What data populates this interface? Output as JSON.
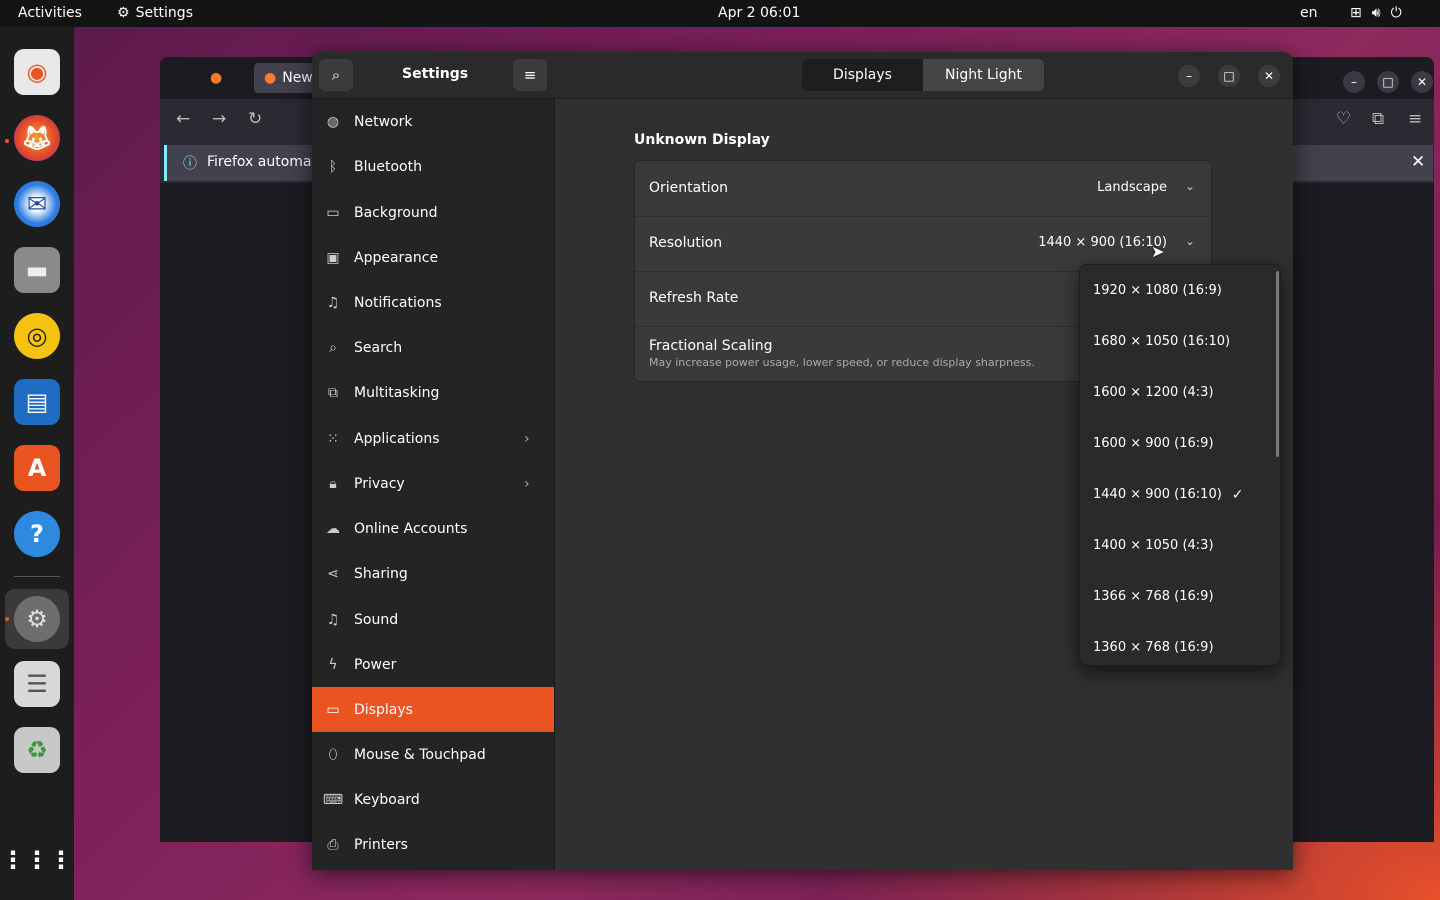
{
  "topbar": {
    "activities": "Activities",
    "app_name": "Settings",
    "clock": "Apr 2  06:01",
    "language": "en"
  },
  "dock": {
    "items": [
      "Ubuntu Logo",
      "Firefox",
      "Thunderbird",
      "Files",
      "Rhythmbox",
      "LibreOffice Writer",
      "Ubuntu Software",
      "Help",
      "Settings",
      "Text Editor",
      "Trash",
      "Show Applications"
    ]
  },
  "firefox": {
    "tab_label": "New",
    "info_bar": "Firefox automat"
  },
  "settings": {
    "title": "Settings",
    "tabs": [
      "Displays",
      "Night Light"
    ],
    "active_tab": "Displays",
    "sidebar": [
      {
        "label": "Network",
        "icon": "network-icon"
      },
      {
        "label": "Bluetooth",
        "icon": "bluetooth-icon"
      },
      {
        "label": "Background",
        "icon": "background-icon"
      },
      {
        "label": "Appearance",
        "icon": "appearance-icon"
      },
      {
        "label": "Notifications",
        "icon": "bell-icon"
      },
      {
        "label": "Search",
        "icon": "search-icon"
      },
      {
        "label": "Multitasking",
        "icon": "multitasking-icon"
      },
      {
        "label": "Applications",
        "icon": "grid-icon",
        "chevron": true
      },
      {
        "label": "Privacy",
        "icon": "lock-icon",
        "chevron": true
      },
      {
        "label": "Online Accounts",
        "icon": "cloud-icon"
      },
      {
        "label": "Sharing",
        "icon": "share-icon"
      },
      {
        "label": "Sound",
        "icon": "music-note-icon"
      },
      {
        "label": "Power",
        "icon": "power-icon"
      },
      {
        "label": "Displays",
        "icon": "display-icon",
        "active": true
      },
      {
        "label": "Mouse & Touchpad",
        "icon": "mouse-icon"
      },
      {
        "label": "Keyboard",
        "icon": "keyboard-icon"
      },
      {
        "label": "Printers",
        "icon": "printer-icon"
      }
    ],
    "display": {
      "section_title": "Unknown Display",
      "orientation_label": "Orientation",
      "orientation_value": "Landscape",
      "resolution_label": "Resolution",
      "resolution_value": "1440 × 900 (16:10)",
      "refresh_label": "Refresh Rate",
      "scaling_label": "Fractional Scaling",
      "scaling_sub": "May increase power usage, lower speed, or reduce display sharpness."
    },
    "resolution_options": [
      {
        "label": "1920 × 1080 (16:9)"
      },
      {
        "label": "1680 × 1050 (16:10)"
      },
      {
        "label": "1600 × 1200 (4:3)"
      },
      {
        "label": "1600 × 900 (16:9)"
      },
      {
        "label": "1440 × 900 (16:10)",
        "selected": true
      },
      {
        "label": "1400 × 1050 (4:3)"
      },
      {
        "label": "1366 × 768 (16:9)"
      },
      {
        "label": "1360 × 768 (16:9)"
      }
    ]
  },
  "colors": {
    "accent": "#e95420",
    "window_bg": "#303030",
    "sidebar_bg": "#242424"
  }
}
